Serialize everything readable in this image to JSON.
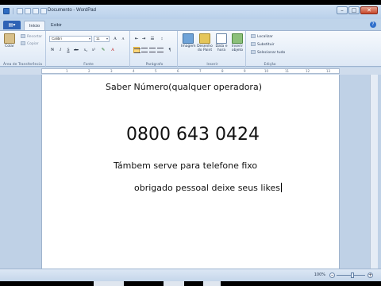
{
  "window": {
    "title": "Documento - WordPad"
  },
  "ribbon_tabs": {
    "file": "",
    "home": "Início",
    "view": "Exibir"
  },
  "clipboard": {
    "paste": "Colar",
    "cut": "Recortar",
    "copy": "Copiar",
    "group": "Área de Transferência"
  },
  "font": {
    "family": "Calibri",
    "size": "11",
    "group": "Fonte",
    "bold": "N",
    "italic": "I",
    "underline": "S",
    "strike": "abc"
  },
  "paragraph": {
    "group": "Parágrafo"
  },
  "insert": {
    "image": "Imagem",
    "paint": "Desenho do Paint",
    "datetime": "Data e hora",
    "object": "Inserir objeto",
    "group": "Inserir"
  },
  "editing": {
    "find": "Localizar",
    "replace": "Substituir",
    "select_all": "Selecionar tudo",
    "group": "Edição"
  },
  "document": {
    "line1": "Saber Número(qualquer operadora)",
    "line2": "0800 643 0424",
    "line3": "Támbem serve para telefone fixo",
    "line4": "obrigado pessoal deixe seus likes"
  },
  "status": {
    "zoom": "100%"
  },
  "colors": {
    "page": "#ffffff",
    "frame": "#bfd4ea",
    "file_tab": "#2e62b5"
  }
}
